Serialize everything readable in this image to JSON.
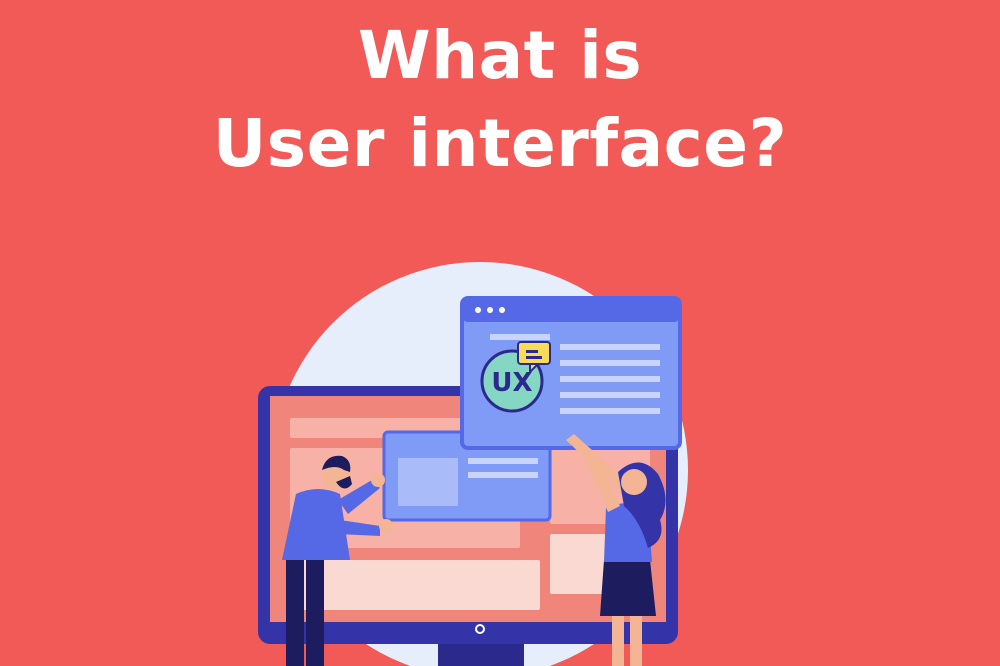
{
  "headline": {
    "line1": "What is",
    "line2": "User interface?"
  },
  "illustration": {
    "badge_text": "UX"
  },
  "colors": {
    "background": "#f25a58",
    "circle": "#e6eefc",
    "monitor_frame": "#3433a8",
    "screen": "#f0857c",
    "window_blue": "#7f9bf5",
    "window_bar": "#5568e6",
    "badge": "#86d6c4",
    "chat_bubble": "#f6dc5a"
  }
}
